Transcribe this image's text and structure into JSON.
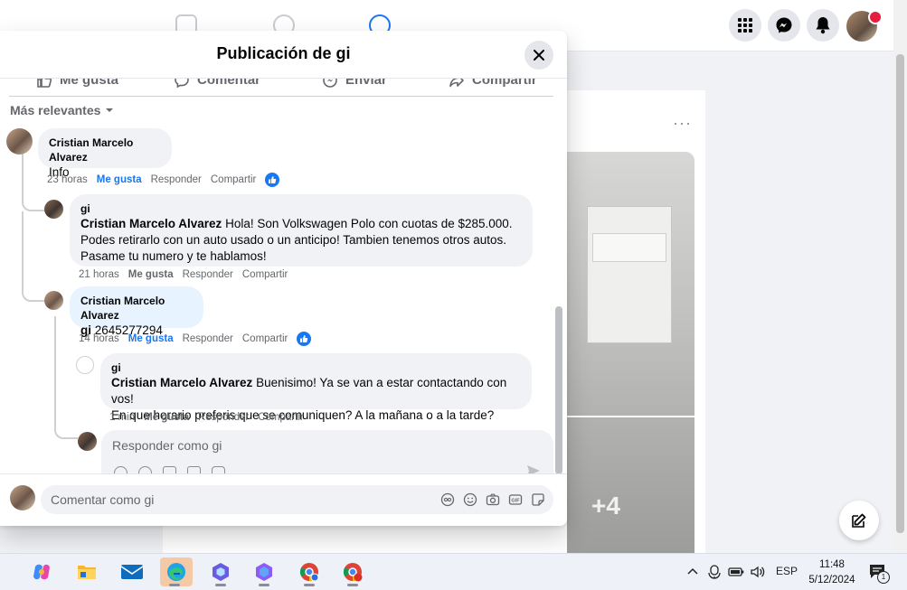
{
  "modal": {
    "title": "Publicación de gi",
    "actions": [
      "Me gusta",
      "Comentar",
      "Enviar",
      "Compartir"
    ],
    "sort_label": "Más relevantes"
  },
  "comments": [
    {
      "author": "Cristian Marcelo Alvarez",
      "text": "Info",
      "time": "23 horas",
      "like": "Me gusta",
      "reply": "Responder",
      "share": "Compartir"
    },
    {
      "author": "gi",
      "mention": "Cristian Marcelo Alvarez",
      "text_line1": " Hola! Son Volkswagen Polo con cuotas de $285.000.",
      "text_line2": "Podes retirarlo con un auto usado o un anticipo! Tambien tenemos otros autos.",
      "text_line3": "Pasame tu numero y te hablamos!",
      "time": "21 horas",
      "like": "Me gusta",
      "reply": "Responder",
      "share": "Compartir"
    },
    {
      "author": "Cristian Marcelo Alvarez",
      "mention": "gi",
      "text": " 2645277294",
      "time": "14 horas",
      "like": "Me gusta",
      "reply": "Responder",
      "share": "Compartir"
    },
    {
      "author": "gi",
      "mention": "Cristian Marcelo Alvarez",
      "text_line1": " Buenisimo! Ya se van a estar contactando con vos!",
      "text_line2": "En que horario preferis que se comuniquen? A la mañana o a la tarde?",
      "time": "1 min",
      "like": "Me gusta",
      "reply": "Responder",
      "share": "Compartir"
    }
  ],
  "reply_placeholder": "Responder como gi",
  "comment_placeholder": "Comentar como gi",
  "feed": {
    "more_photos": "+4",
    "menu_dots": "···"
  },
  "taskbar": {
    "language": "ESP",
    "time": "11:48",
    "date": "5/12/2024",
    "notification_count": "1"
  },
  "colors": {
    "accent": "#1877f2",
    "notification": "#e41e3f",
    "active_app": "#f5c9a6"
  }
}
